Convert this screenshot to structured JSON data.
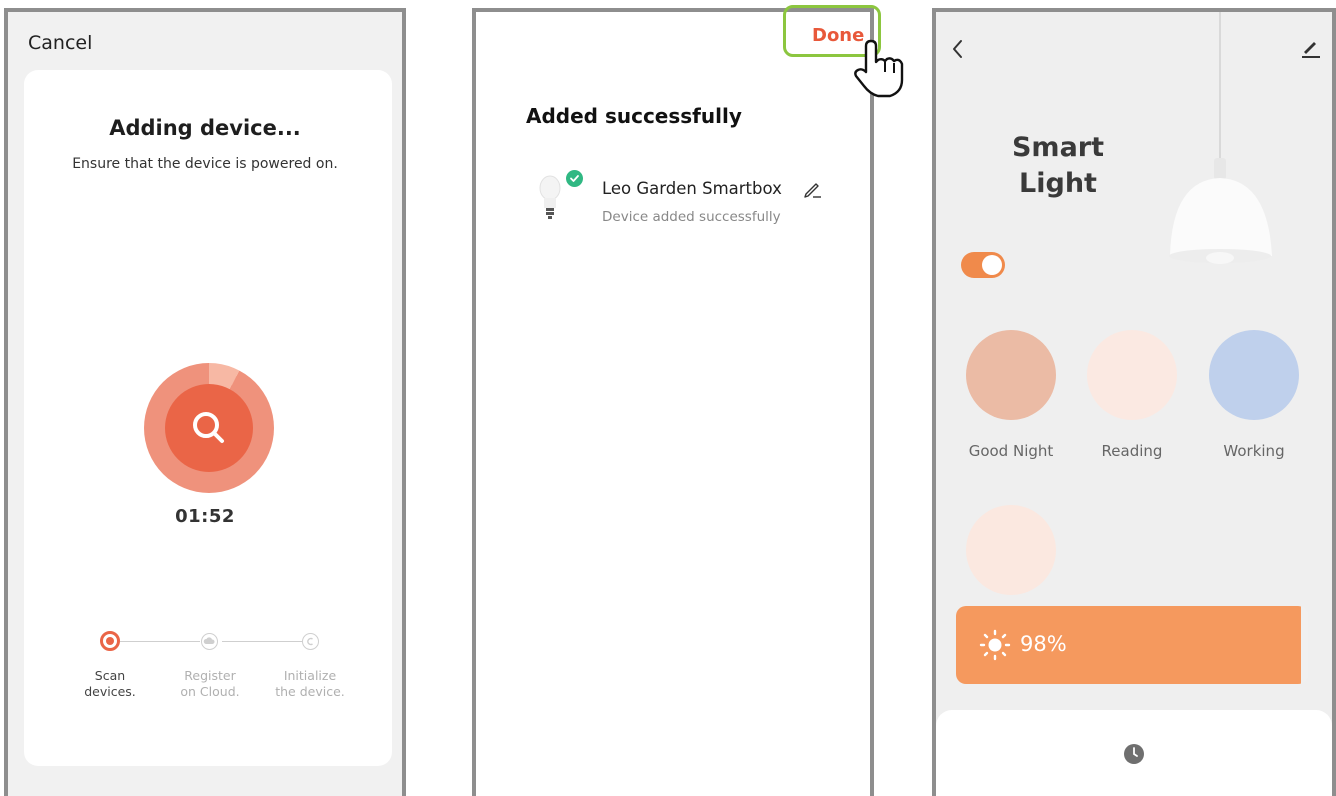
{
  "screen1": {
    "cancel_label": "Cancel",
    "title": "Adding device...",
    "subtitle": "Ensure that the device is powered on.",
    "timer": "01:52",
    "steps": [
      {
        "label_line1": "Scan",
        "label_line2": "devices.",
        "active": true
      },
      {
        "label_line1": "Register",
        "label_line2": "on Cloud.",
        "active": false
      },
      {
        "label_line1": "Initialize",
        "label_line2": "the device.",
        "active": false
      }
    ],
    "accent_color": "#ea6547"
  },
  "screen2": {
    "done_label": "Done",
    "title": "Added successfully",
    "device": {
      "name": "Leo Garden Smartbox",
      "status": "Device added successfully"
    },
    "highlight_color": "#8cc63f",
    "success_color": "#30b883"
  },
  "screen3": {
    "title_line1": "Smart",
    "title_line2": "Light",
    "power_on": true,
    "scenes": [
      {
        "label": "Good Night",
        "color": "#ebbba5"
      },
      {
        "label": "Reading",
        "color": "#fbe9e2"
      },
      {
        "label": "Working",
        "color": "#bfd0ec"
      },
      {
        "label": "",
        "color": "#fbe8e0"
      }
    ],
    "brightness_text": "98%",
    "brightness_level": 0.98,
    "accent_color": "#f5995e",
    "icons": [
      "back-arrow-icon",
      "edit-icon",
      "sun-icon",
      "clock-icon"
    ]
  }
}
